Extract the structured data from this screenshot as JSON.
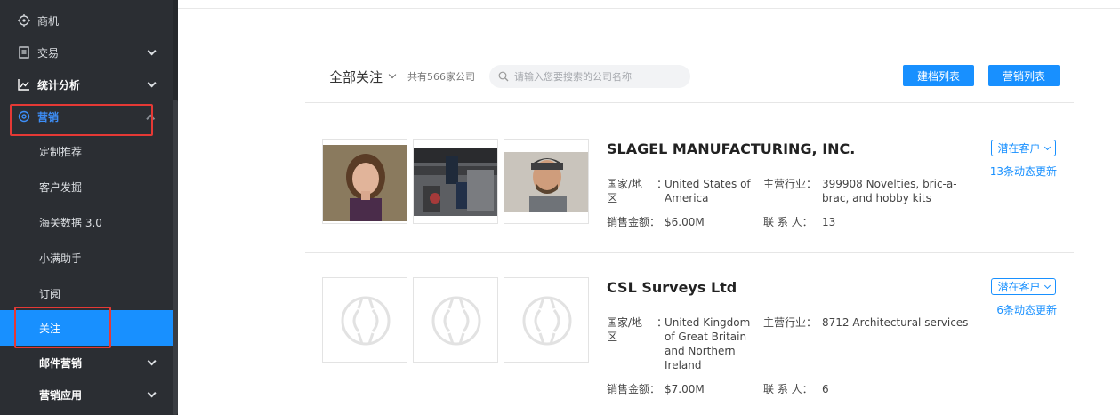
{
  "sidebar": {
    "items": [
      {
        "label": "商机",
        "icon": "target-icon"
      },
      {
        "label": "交易",
        "icon": "document-icon"
      },
      {
        "label": "统计分析",
        "icon": "chart-line-icon"
      },
      {
        "label": "营销",
        "icon": "circle-target-icon"
      }
    ],
    "subitems": [
      "定制推荐",
      "客户发掘",
      "海关数据 3.0",
      "小满助手",
      "订阅",
      "关注",
      "邮件营销",
      "营销应用"
    ]
  },
  "toolbar": {
    "filter_label": "全部关注",
    "count_label": "共有566家公司",
    "search_placeholder": "请输入您要搜索的公司名称",
    "archive_button": "建档列表",
    "marketing_button": "营销列表"
  },
  "labels": {
    "country": "国家/地区",
    "country_l1": "国家/地",
    "country_l2": "区",
    "industry": "主营行业：",
    "sales": "销售金额：",
    "contacts": "联 系 人："
  },
  "companies": [
    {
      "name": "SLAGEL MANUFACTURING, INC.",
      "country": "United States of America",
      "industry": "399908 Novelties, bric-a-brac, and hobby kits",
      "sales": "$6.00M",
      "contacts": "13",
      "status": "潜在客户",
      "updates": "13条动态更新"
    },
    {
      "name": "CSL Surveys Ltd",
      "country": "United Kingdom of Great Britain and Northern Ireland",
      "industry": "8712 Architectural services",
      "sales": "$7.00M",
      "contacts": "6",
      "status": "潜在客户",
      "updates": "6条动态更新"
    }
  ],
  "colors": {
    "sidebar_bg": "#2b2e33",
    "accent": "#1890ff",
    "highlight": "#e53935"
  }
}
